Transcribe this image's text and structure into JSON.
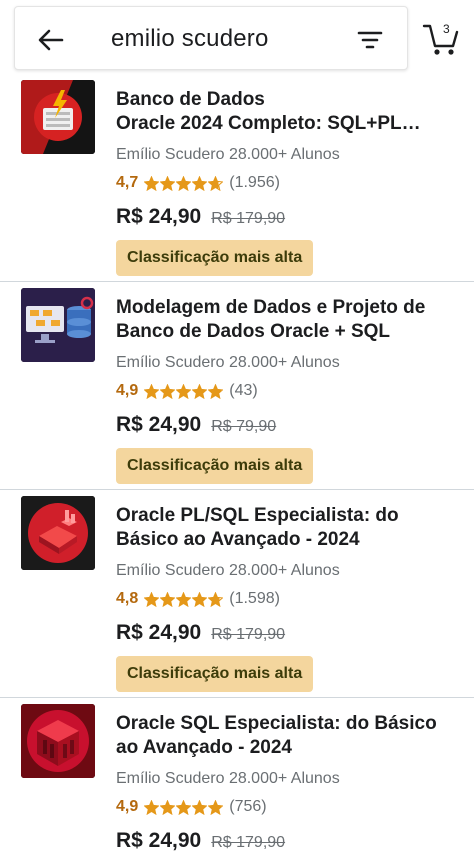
{
  "search": {
    "query": "emilio scudero",
    "back_icon": "arrow-left-icon",
    "filter_icon": "filter-icon",
    "cart_icon": "cart-icon",
    "cart_count": "3"
  },
  "courses": [
    {
      "title": "Banco de Dados\nOracle 2024 Completo: SQL+PL…",
      "author": "Emílio Scudero 28.000+ Alunos",
      "rating": "4,7",
      "stars": 4.7,
      "reviews": "(1.956)",
      "price": "R$ 24,90",
      "old_price": "R$ 179,90",
      "badge": "Classificação mais alta"
    },
    {
      "title": "Modelagem de Dados e Projeto de\nBanco de Dados Oracle + SQL",
      "author": "Emílio Scudero 28.000+ Alunos",
      "rating": "4,9",
      "stars": 4.9,
      "reviews": "(43)",
      "price": "R$ 24,90",
      "old_price": "R$ 79,90",
      "badge": "Classificação mais alta"
    },
    {
      "title": "Oracle PL/SQL Especialista: do\nBásico ao Avançado - 2024",
      "author": "Emílio Scudero 28.000+ Alunos",
      "rating": "4,8",
      "stars": 4.8,
      "reviews": "(1.598)",
      "price": "R$ 24,90",
      "old_price": "R$ 179,90",
      "badge": "Classificação mais alta"
    },
    {
      "title": "Oracle SQL Especialista: do Básico\nao Avançado - 2024",
      "author": "Emílio Scudero 28.000+ Alunos",
      "rating": "4,9",
      "stars": 4.9,
      "reviews": "(756)",
      "price": "R$ 24,90",
      "old_price": "R$ 179,90",
      "badge": ""
    }
  ],
  "colors": {
    "star": "#e59819",
    "rating": "#b4690e",
    "badge_bg": "#f4d69e",
    "oracle_red": "#c8102e"
  }
}
